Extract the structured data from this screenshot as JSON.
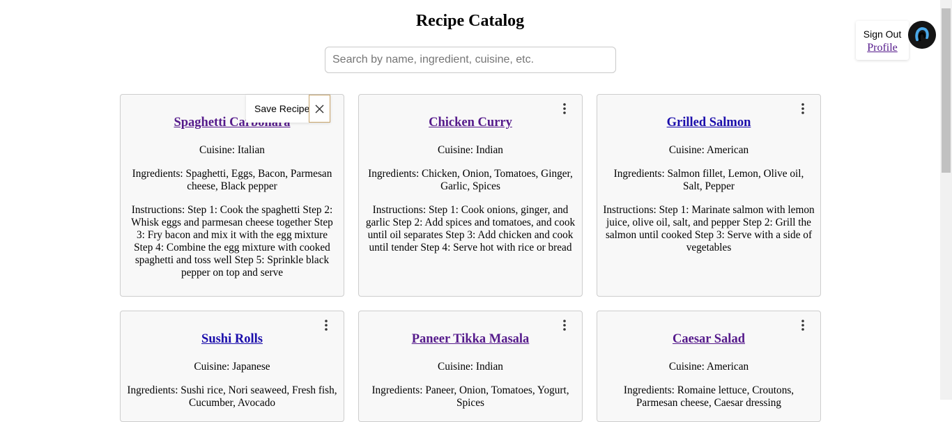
{
  "header": {
    "title": "Recipe Catalog",
    "search_placeholder": "Search by name, ingredient, cuisine, etc."
  },
  "user": {
    "sign_out": "Sign Out",
    "profile": "Profile",
    "avatar_icon": "user-avatar-icon"
  },
  "save_popup": {
    "label": "Save Recipe",
    "close_icon": "close-icon"
  },
  "recipes": [
    {
      "name": "Spaghetti Carbonara",
      "visited": true,
      "cuisine": "Cuisine: Italian",
      "ingredients": "Ingredients: Spaghetti, Eggs, Bacon, Parmesan cheese, Black pepper",
      "instructions": "Instructions: Step 1: Cook the spaghetti Step 2: Whisk eggs and parmesan cheese together Step 3: Fry bacon and mix it with the egg mixture Step 4: Combine the egg mixture with cooked spaghetti and toss well Step 5: Sprinkle black pepper on top and serve"
    },
    {
      "name": "Chicken Curry",
      "visited": true,
      "cuisine": "Cuisine: Indian",
      "ingredients": "Ingredients: Chicken, Onion, Tomatoes, Ginger, Garlic, Spices",
      "instructions": "Instructions: Step 1: Cook onions, ginger, and garlic Step 2: Add spices and tomatoes, and cook until oil separates Step 3: Add chicken and cook until tender Step 4: Serve hot with rice or bread"
    },
    {
      "name": "Grilled Salmon",
      "visited": false,
      "cuisine": "Cuisine: American",
      "ingredients": "Ingredients: Salmon fillet, Lemon, Olive oil, Salt, Pepper",
      "instructions": "Instructions: Step 1: Marinate salmon with lemon juice, olive oil, salt, and pepper Step 2: Grill the salmon until cooked Step 3: Serve with a side of vegetables"
    },
    {
      "name": "Sushi Rolls",
      "visited": false,
      "cuisine": "Cuisine: Japanese",
      "ingredients": "Ingredients: Sushi rice, Nori seaweed, Fresh fish, Cucumber, Avocado",
      "instructions": ""
    },
    {
      "name": "Paneer Tikka Masala",
      "visited": true,
      "cuisine": "Cuisine: Indian",
      "ingredients": "Ingredients: Paneer, Onion, Tomatoes, Yogurt, Spices",
      "instructions": ""
    },
    {
      "name": "Caesar Salad",
      "visited": true,
      "cuisine": "Cuisine: American",
      "ingredients": "Ingredients: Romaine lettuce, Croutons, Parmesan cheese, Caesar dressing",
      "instructions": ""
    }
  ],
  "colors": {
    "link": "#1a0dab",
    "visited_link": "#551a8b"
  }
}
